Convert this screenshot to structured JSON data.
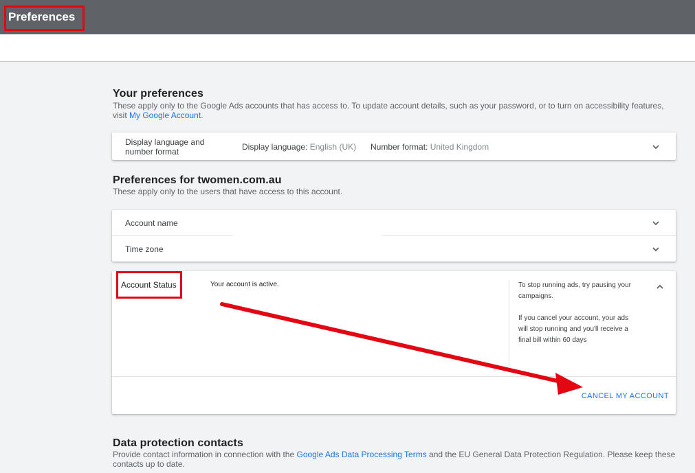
{
  "header": {
    "title": "Preferences"
  },
  "your_preferences": {
    "title": "Your preferences",
    "desc_line1": "These apply only to the Google Ads accounts that has access to. To update account details, such as your password, or to turn on accessibility features,",
    "desc_line2_prefix": "visit ",
    "desc_link": "My Google Account",
    "desc_line2_suffix": ".",
    "language_row": {
      "label_line1": "Display language and",
      "label_line2": "number format",
      "display_language_label": "Display language:",
      "display_language_value": "English (UK)",
      "number_format_label": "Number format:",
      "number_format_value": "United Kingdom"
    }
  },
  "account_preferences": {
    "title": "Preferences for twomen.com.au",
    "desc": "These apply only to the users that have access to this account.",
    "account_name_label": "Account name",
    "time_zone_label": "Time zone"
  },
  "account_status": {
    "label": "Account Status",
    "status_text": "Your account is active.",
    "help_line1": "To stop running ads, try pausing your",
    "help_line2": "campaigns.",
    "help_line3": "If you cancel your account, your ads",
    "help_line4": "will stop running and you'll receive a",
    "help_line5": "final bill within 60 days",
    "cancel_label": "CANCEL MY ACCOUNT"
  },
  "data_protection": {
    "title": "Data protection contacts",
    "desc_prefix": "Provide contact information in connection with the ",
    "desc_link": "Google Ads Data Processing Terms",
    "desc_suffix": " and the EU General Data Protection Regulation. Please keep these",
    "desc_line2": "contacts up to date."
  },
  "annotation_color": "#e30613",
  "accent_color": "#1a73e8"
}
